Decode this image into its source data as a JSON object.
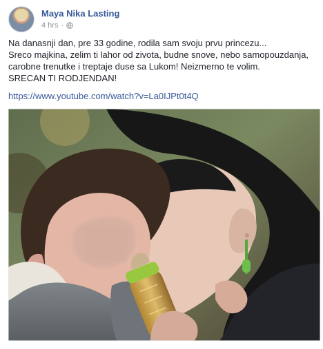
{
  "post": {
    "author": "Maya Nika Lasting",
    "time": "4 hrs",
    "separator": "·",
    "privacy_icon": "globe-icon",
    "text_lines": [
      "Na danasnji dan, pre 33 godine, rodila sam svoju prvu princezu...",
      "Sreco majkina, zelim ti lahor od zivota, budne snove, nebo samopouzdanja,",
      "carobne trenutke i treptaje duse sa Lukom! Neizmerno te volim.",
      "SRECAN TI RODJENDAN!"
    ],
    "link": "https://www.youtube.com/watch?v=La0IJPt0t4Q"
  },
  "colors": {
    "author": "#365899",
    "link": "#365899",
    "meta": "#90949c",
    "text": "#1d2129"
  }
}
